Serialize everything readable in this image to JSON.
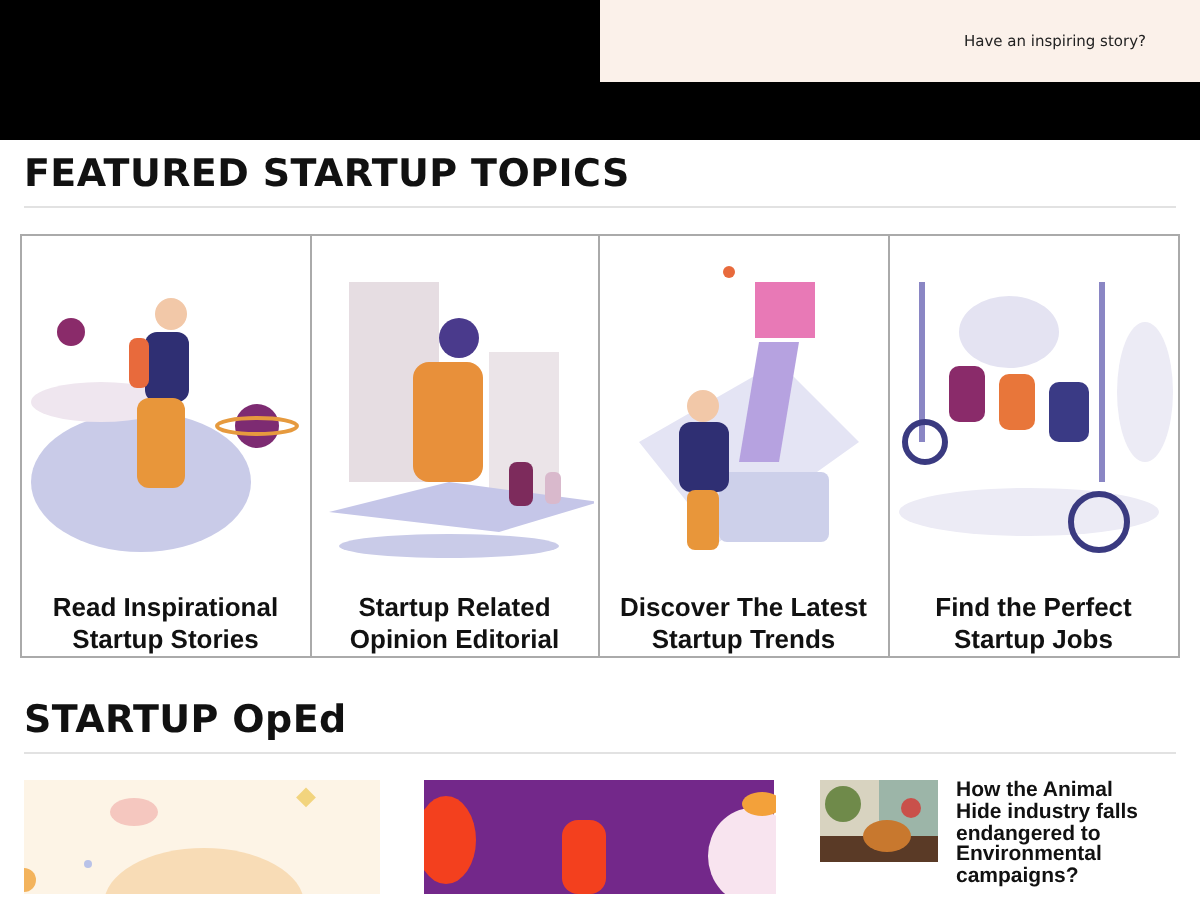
{
  "banner": {
    "text": "Have an inspiring story?"
  },
  "featured": {
    "heading": "FEATURED STARTUP TOPICS",
    "cards": [
      {
        "title": "Read Inspirational Startup Stories"
      },
      {
        "title": "Startup Related Opinion Editorial"
      },
      {
        "title": "Discover The Latest Startup Trends"
      },
      {
        "title": "Find the Perfect Startup Jobs"
      }
    ]
  },
  "oped": {
    "heading": "STARTUP OpEd",
    "articles": [
      {
        "kind": "large"
      },
      {
        "kind": "large"
      },
      {
        "kind": "thumb",
        "title": "How the Animal Hide industry falls endangered to Environmental campaigns?"
      }
    ]
  }
}
